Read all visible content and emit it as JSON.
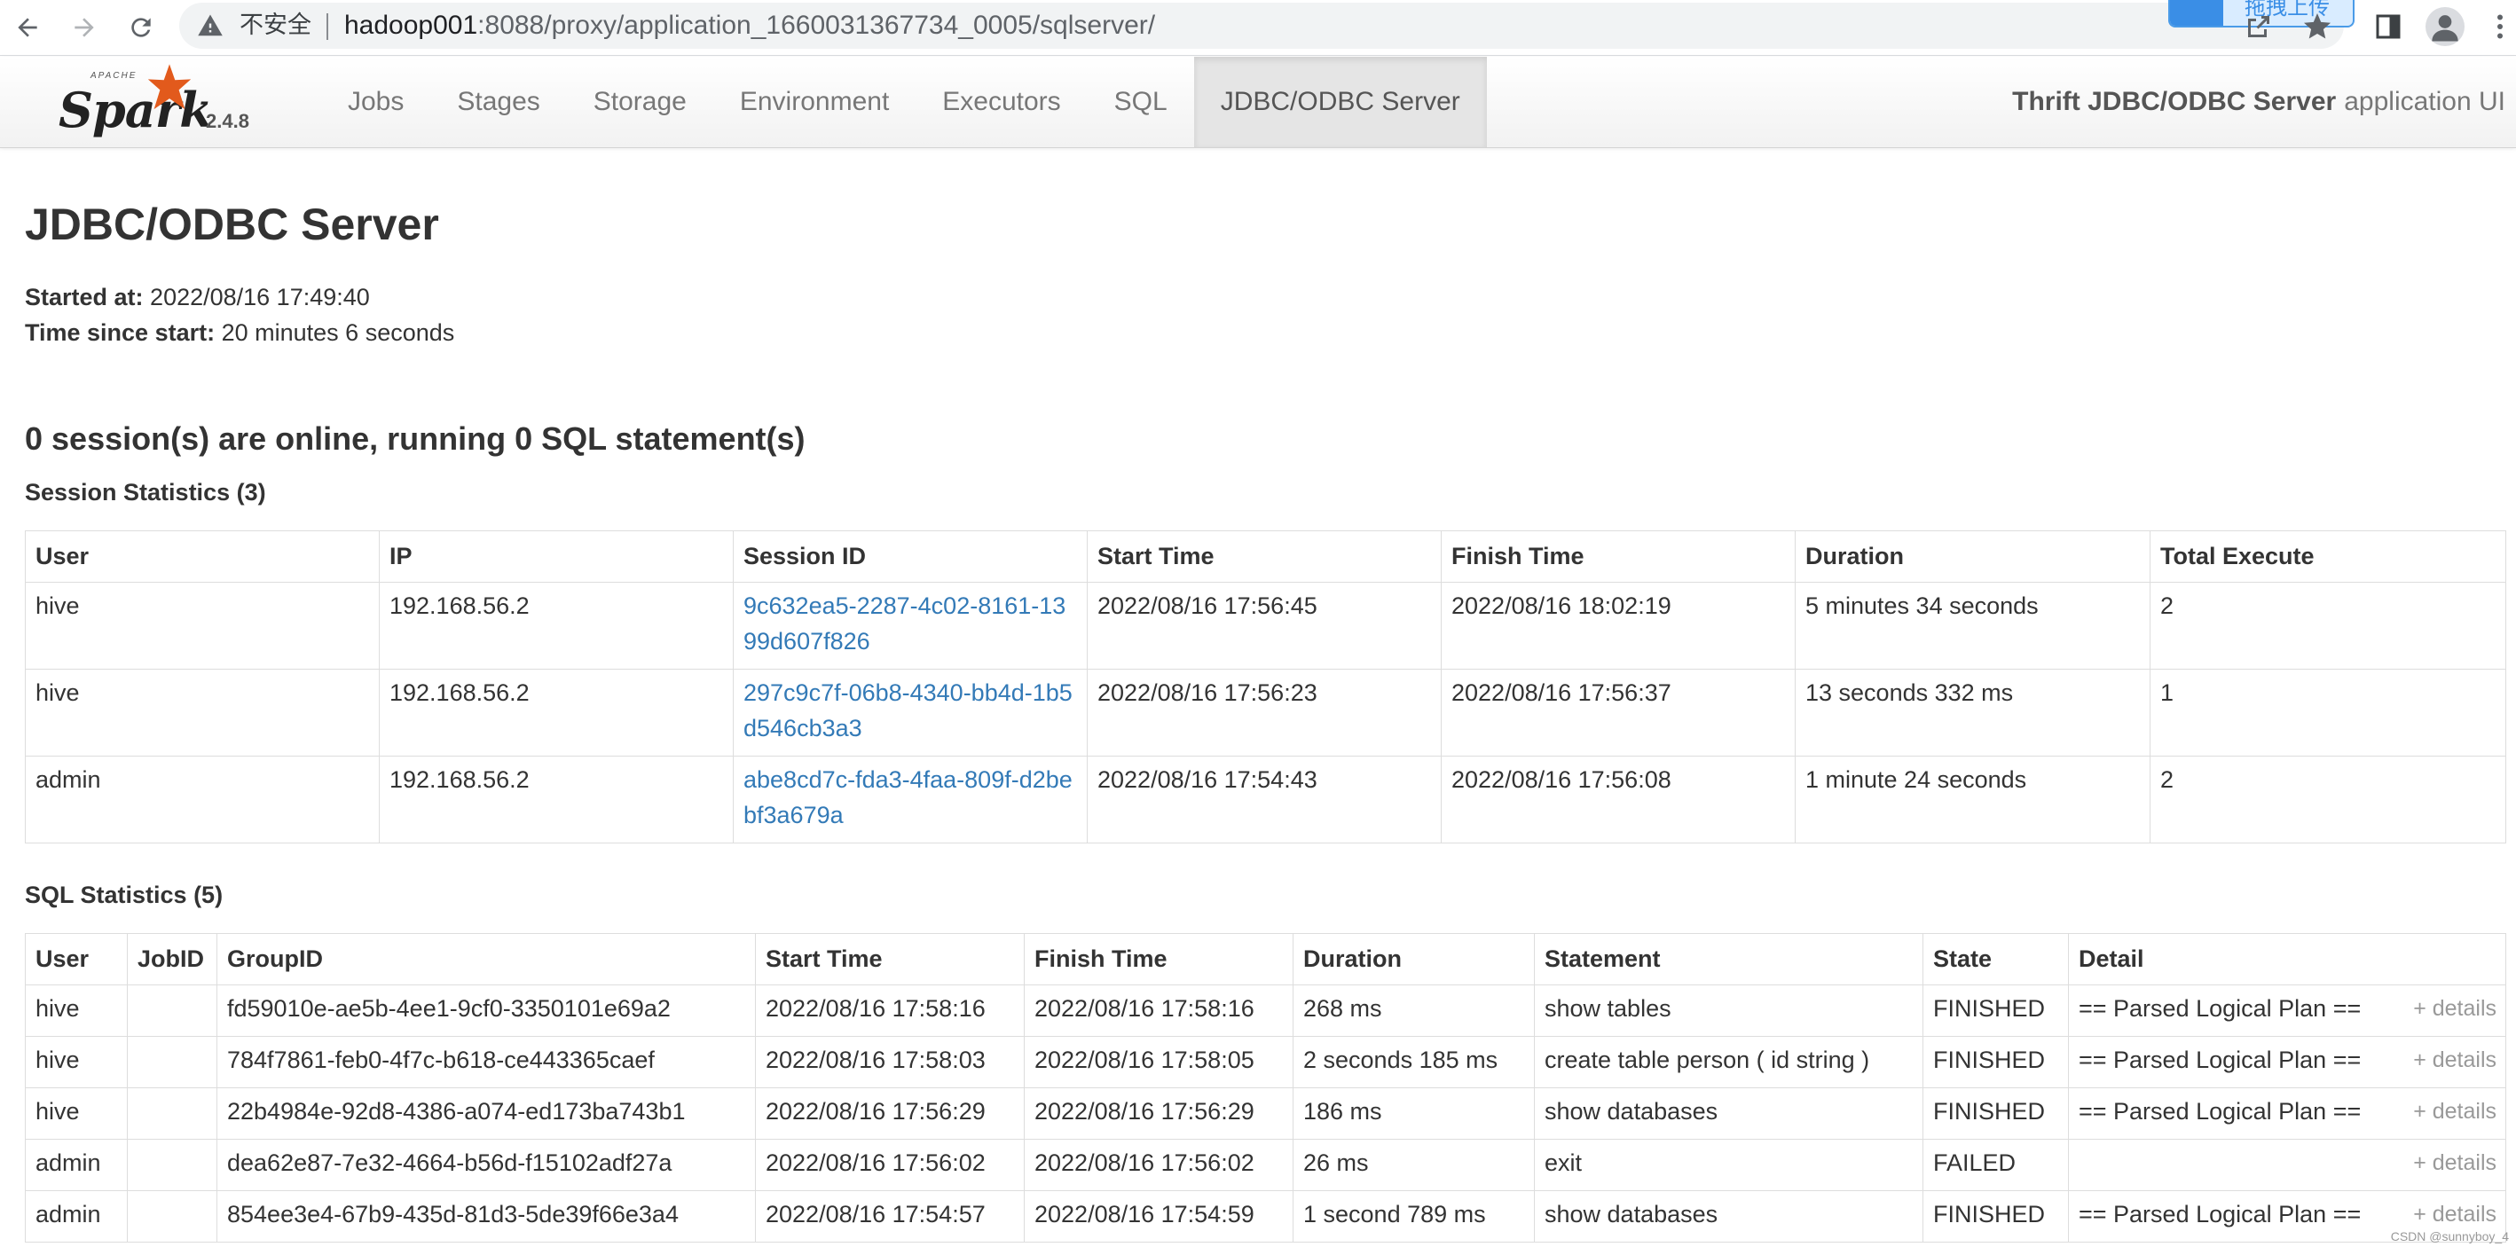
{
  "browser": {
    "insecure_label": "不安全",
    "url_host": "hadoop001",
    "url_rest": ":8088/proxy/application_1660031367734_0005/sqlserver/",
    "upload_label": "拖拽上传"
  },
  "navbar": {
    "brand_apache": "APACHE",
    "brand_name": "Spark",
    "version": "2.4.8",
    "tabs": [
      "Jobs",
      "Stages",
      "Storage",
      "Environment",
      "Executors",
      "SQL",
      "JDBC/ODBC Server"
    ],
    "active_tab": "JDBC/ODBC Server",
    "app_title_bold": "Thrift JDBC/ODBC Server",
    "app_title_rest": "application UI"
  },
  "page": {
    "title": "JDBC/ODBC Server",
    "started_label": "Started at:",
    "started_value": "2022/08/16 17:49:40",
    "since_label": "Time since start:",
    "since_value": "20 minutes 6 seconds",
    "online_summary": "0 session(s) are online, running 0 SQL statement(s)"
  },
  "session_stats": {
    "title": "Session Statistics (3)",
    "headers": [
      "User",
      "IP",
      "Session ID",
      "Start Time",
      "Finish Time",
      "Duration",
      "Total Execute"
    ],
    "rows": [
      {
        "user": "hive",
        "ip": "192.168.56.2",
        "session_id": "9c632ea5-2287-4c02-8161-1399d607f826",
        "start": "2022/08/16 17:56:45",
        "finish": "2022/08/16 18:02:19",
        "duration": "5 minutes 34 seconds",
        "total": "2"
      },
      {
        "user": "hive",
        "ip": "192.168.56.2",
        "session_id": "297c9c7f-06b8-4340-bb4d-1b5d546cb3a3",
        "start": "2022/08/16 17:56:23",
        "finish": "2022/08/16 17:56:37",
        "duration": "13 seconds 332 ms",
        "total": "1"
      },
      {
        "user": "admin",
        "ip": "192.168.56.2",
        "session_id": "abe8cd7c-fda3-4faa-809f-d2bebf3a679a",
        "start": "2022/08/16 17:54:43",
        "finish": "2022/08/16 17:56:08",
        "duration": "1 minute 24 seconds",
        "total": "2"
      }
    ]
  },
  "sql_stats": {
    "title": "SQL Statistics (5)",
    "headers": [
      "User",
      "JobID",
      "GroupID",
      "Start Time",
      "Finish Time",
      "Duration",
      "Statement",
      "State",
      "Detail"
    ],
    "details_label": "+ details",
    "rows": [
      {
        "user": "hive",
        "jobid": "",
        "groupid": "fd59010e-ae5b-4ee1-9cf0-3350101e69a2",
        "start": "2022/08/16 17:58:16",
        "finish": "2022/08/16 17:58:16",
        "duration": "268 ms",
        "statement": "show tables",
        "state": "FINISHED",
        "detail": "== Parsed Logical Plan =="
      },
      {
        "user": "hive",
        "jobid": "",
        "groupid": "784f7861-feb0-4f7c-b618-ce443365caef",
        "start": "2022/08/16 17:58:03",
        "finish": "2022/08/16 17:58:05",
        "duration": "2 seconds 185 ms",
        "statement": "create table person ( id string )",
        "state": "FINISHED",
        "detail": "== Parsed Logical Plan =="
      },
      {
        "user": "hive",
        "jobid": "",
        "groupid": "22b4984e-92d8-4386-a074-ed173ba743b1",
        "start": "2022/08/16 17:56:29",
        "finish": "2022/08/16 17:56:29",
        "duration": "186 ms",
        "statement": "show databases",
        "state": "FINISHED",
        "detail": "== Parsed Logical Plan =="
      },
      {
        "user": "admin",
        "jobid": "",
        "groupid": "dea62e87-7e32-4664-b56d-f15102adf27a",
        "start": "2022/08/16 17:56:02",
        "finish": "2022/08/16 17:56:02",
        "duration": "26 ms",
        "statement": "exit",
        "state": "FAILED",
        "detail": ""
      },
      {
        "user": "admin",
        "jobid": "",
        "groupid": "854ee3e4-67b9-435d-81d3-5de39f66e3a4",
        "start": "2022/08/16 17:54:57",
        "finish": "2022/08/16 17:54:59",
        "duration": "1 second 789 ms",
        "statement": "show databases",
        "state": "FINISHED",
        "detail": "== Parsed Logical Plan =="
      }
    ]
  },
  "watermark": "CSDN @sunnyboy_4",
  "colors": {
    "link": "#337ab7",
    "active_tab_bg": "#e5e5e5",
    "spark_star": "#e25a1c"
  }
}
